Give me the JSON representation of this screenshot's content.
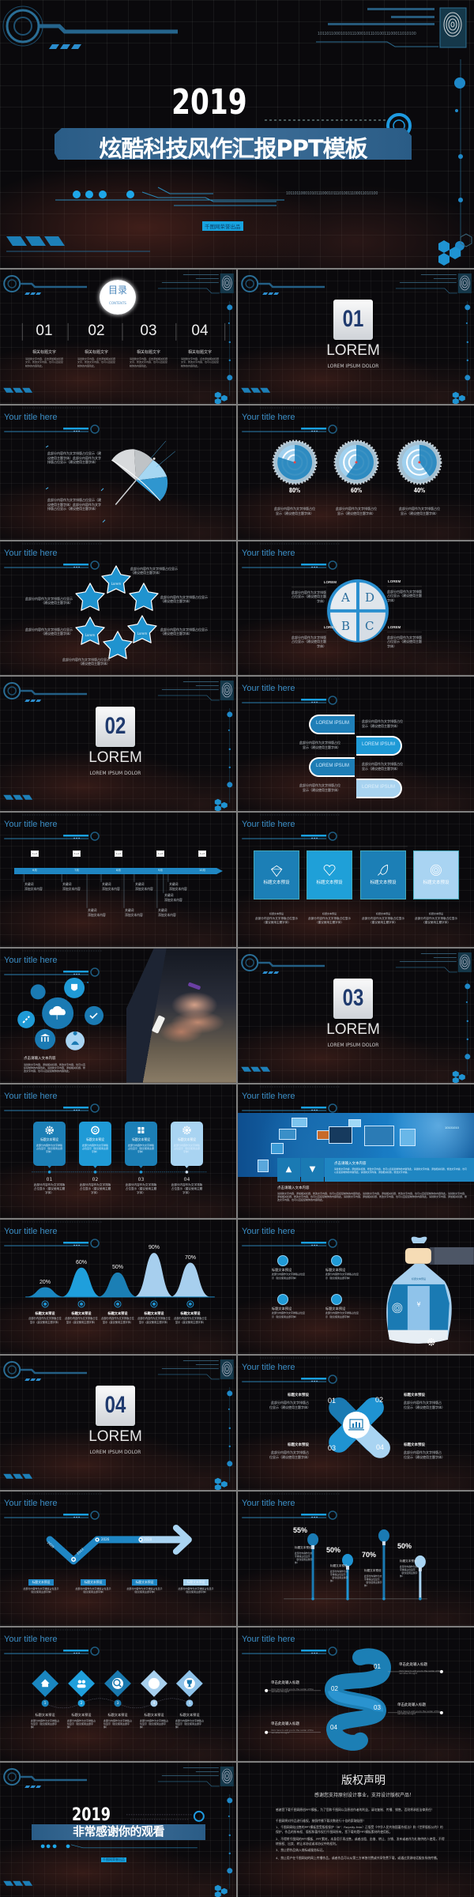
{
  "colors": {
    "accent": "#1f93d2",
    "accent_dark": "#1a7ab3",
    "accent_light": "#a9d3f1",
    "section_number": "#1f3a6e",
    "background": "#0a090c",
    "title_blue": "#3b8ec6"
  },
  "cover": {
    "year": "2019",
    "title": "炫酷科技风作汇报PPT模板",
    "tag": "千图网荣誉出品",
    "binary_top": "1011011000101011100010111010011100011010100",
    "binary_mid": "1011011000101011100010111010011100011010100"
  },
  "common": {
    "slide_title": "Your title here"
  },
  "slides": [
    {
      "type": "contents",
      "heading": "目录",
      "heading_en": "CONTENTS",
      "items": [
        {
          "num": "01",
          "label": "相关标题文字",
          "desc": "请替换文字内容，点击添加相关标题文字，修改文字内容，也可以直接复制你的内容到此。"
        },
        {
          "num": "02",
          "label": "相关标题文字",
          "desc": "请替换文字内容，点击添加相关标题文字，修改文字内容，也可以直接复制你的内容到此。"
        },
        {
          "num": "03",
          "label": "相关标题文字",
          "desc": "请替换文字内容，点击添加相关标题文字，修改文字内容，也可以直接复制你的内容到此。"
        },
        {
          "num": "04",
          "label": "相关标题文字",
          "desc": "请替换文字内容，点击添加相关标题文字，修改文字内容，也可以直接复制你的内容到此。"
        }
      ]
    },
    {
      "type": "section",
      "num": "01",
      "title": "LOREM",
      "subtitle": "LOREM IPSUM DOLOR"
    },
    {
      "type": "umbrella",
      "texts": [
        "此部分内容作为文字排版占位显示（建议使用主题字体）此部分内容作为文字排版占位显示（建议使用主题字体）",
        "此部分内容作为文字排版占位显示（建议使用主题字体）此部分内容作为文字排版占位显示（建议使用主题字体）"
      ]
    },
    {
      "type": "targets",
      "items": [
        {
          "pct": "80%",
          "value": 80,
          "text": "此部分内容作为文字排版占位显示（建议使用主题字体）"
        },
        {
          "pct": "60%",
          "value": 60,
          "text": "此部分内容作为文字排版占位显示（建议使用主题字体）"
        },
        {
          "pct": "40%",
          "value": 40,
          "text": "此部分内容作为文字排版占位显示（建议使用主题字体）"
        }
      ]
    },
    {
      "type": "stars",
      "labels": [
        "Lorem",
        "Lorem",
        "Lorem",
        "Lorem",
        "Lorem",
        "Lorem"
      ],
      "icons": [
        "user-icon",
        "home-icon",
        "heart-icon",
        "music-icon",
        "search-icon",
        "link-icon"
      ],
      "texts": [
        "此部分内容作为文字排版占位显示（建议使用主题字体）",
        "此部分内容作为文字排版占位显示（建议使用主题字体）",
        "此部分内容作为文字排版占位显示（建议使用主题字体）",
        "此部分内容作为文字排版占位显示（建议使用主题字体）",
        "此部分内容作为文字排版占位显示（建议使用主题字体）",
        "此部分内容作为文字排版占位显示（建议使用主题字体）"
      ]
    },
    {
      "type": "abcd",
      "letters": [
        "A",
        "D",
        "B",
        "C"
      ],
      "items": [
        {
          "label": "LOREM",
          "text": "此部分内容作为文字排版占位显示（建议使用主题字体）"
        },
        {
          "label": "LOREM",
          "text": "此部分内容作为文字排版占位显示（建议使用主题字体）"
        },
        {
          "label": "LOREM",
          "text": "此部分内容作为文字排版占位显示（建议使用主题字体）"
        },
        {
          "label": "LOREM",
          "text": "此部分内容作为文字排版占位显示（建议使用主题字体）"
        }
      ]
    },
    {
      "type": "section",
      "num": "02",
      "title": "LOREM",
      "subtitle": "LOREM IPSUM DOLOR"
    },
    {
      "type": "pills",
      "items": [
        {
          "label": "LOREM IPSUM",
          "text": "此部分内容作为文字排版占位显示（建议使用主题字体）"
        },
        {
          "label": "LOREM IPSUM",
          "text": "此部分内容作为文字排版占位显示（建议使用主题字体）"
        },
        {
          "label": "LOREM IPSUM",
          "text": "此部分内容作为文字排版占位显示（建议使用主题字体）"
        },
        {
          "label": "LOREM IPSUM",
          "text": "此部分内容作为文字排版占位显示（建议使用主题字体）"
        }
      ]
    },
    {
      "type": "timeline",
      "icon_label": "1+2",
      "months": [
        "6月",
        "7月",
        "8月",
        "9月",
        "10月"
      ],
      "items": [
        {
          "kw": "关键词",
          "text": "添加文本内容"
        },
        {
          "kw": "关键词",
          "text": "添加文本内容"
        },
        {
          "kw": "关键词",
          "text": "添加文本内容"
        },
        {
          "kw": "关键词",
          "text": "添加文本内容"
        },
        {
          "kw": "关键词",
          "text": "添加文本内容"
        },
        {
          "kw": "关键词",
          "text": "添加文本内容"
        },
        {
          "kw": "关键词",
          "text": "添加文本内容"
        },
        {
          "kw": "关键词",
          "text": "添加文本内容"
        },
        {
          "kw": "关键词",
          "text": "添加文本内容"
        }
      ]
    },
    {
      "type": "boxes",
      "items": [
        {
          "icon": "diamond-icon",
          "label": "标题文本预设",
          "cap_title": "标题文本预设",
          "caption": "此部分内容作为文字排版占位显示（建议使用主题字体）"
        },
        {
          "icon": "heart-icon",
          "label": "标题文本预设",
          "cap_title": "标题文本预设",
          "caption": "此部分内容作为文字排版占位显示（建议使用主题字体）"
        },
        {
          "icon": "rocket-icon",
          "label": "标题文本预设",
          "cap_title": "标题文本预设",
          "caption": "此部分内容作为文字排版占位显示（建议使用主题字体）"
        },
        {
          "icon": "target-icon",
          "label": "标题文本预设",
          "cap_title": "标题文本预设",
          "caption": "此部分内容作为文字排版占位显示（建议使用主题字体）"
        }
      ]
    },
    {
      "type": "circles",
      "cap_title": "点击请输入文本内容",
      "caption": "请替换文字内容，添加相关标题，修改文字内容，也可以直接复制你的内容到此。请替换文字内容，添加相关标题，修改文字内容，也可以直接复制你的内容到此。"
    },
    {
      "type": "section",
      "num": "03",
      "title": "LOREM",
      "subtitle": "LOREM IPSUM DOLOR"
    },
    {
      "type": "cards",
      "items": [
        {
          "icon": "gear-icon",
          "label": "标题文本预设",
          "text": "此部分内容作为文字排版占位显示（建议使用主题字体）",
          "num": "01",
          "caption": "此部分内容作为文字排版占位显示（建议使用主题字体）"
        },
        {
          "icon": "aperture-icon",
          "label": "标题文本预设",
          "text": "此部分内容作为文字排版占位显示（建议使用主题字体）",
          "num": "02",
          "caption": "此部分内容作为文字排版占位显示（建议使用主题字体）"
        },
        {
          "icon": "windows-icon",
          "label": "标题文本预设",
          "text": "此部分内容作为文字排版占位显示（建议使用主题字体）",
          "num": "03",
          "caption": "此部分内容作为文字排版占位显示（建议使用主题字体）"
        },
        {
          "icon": "gear-icon",
          "label": "标题文本预设",
          "text": "此部分内容作为文字排版占位显示（建议使用主题字体）",
          "num": "04",
          "caption": "此部分内容作为文字排版占位显示（建议使用主题字体）"
        }
      ]
    },
    {
      "type": "banner",
      "panel_title": "点击请输入文本内容",
      "panel_text": "请替换文字内容，添加相关标题，修改文字内容，也可以直接复制你的内容到此。请替换文字内容，添加相关标题，修改文字内容，也可以直接复制你的内容到此。请替换文字内容，添加相关标题，修改文字内容。",
      "binary": "10101010",
      "below_title": "点击请输入文本内容",
      "below_text": "请替换文字内容，添加相关标题，修改文字内容，也可以直接复制你的内容到此。请替换文字内容，添加相关标题，修改文字内容，也可以直接复制你的内容到此。请替换文字内容，添加相关标题，修改文字内容，也可以直接复制你的内容到此。请替换文字内容，添加相关标题，修改文字内容，也可以直接复制你的内容到此。请替换文字内容，添加相关标题，修改文字内容，也可以直接复制你的内容到此。"
    },
    {
      "type": "curves",
      "items": [
        {
          "value": 20,
          "pct": "20%",
          "title": "标题文本预设",
          "text": "此部分内容作为文字排版占位显示（建议使用主题字体）"
        },
        {
          "value": 60,
          "pct": "60%",
          "title": "标题文本预设",
          "text": "此部分内容作为文字排版占位显示（建议使用主题字体）"
        },
        {
          "value": 50,
          "pct": "50%",
          "title": "标题文本预设",
          "text": "此部分内容作为文字排版占位显示（建议使用主题字体）"
        },
        {
          "value": 90,
          "pct": "90%",
          "title": "标题文本预设",
          "text": "此部分内容作为文字排版占位显示（建议使用主题字体）"
        },
        {
          "value": 70,
          "pct": "70%",
          "title": "标题文本预设",
          "text": "此部分内容作为文字排版占位显示（建议使用主题字体）"
        }
      ]
    },
    {
      "type": "moneybag",
      "bag_label": "标题文本预设",
      "bag_symbol": "¥",
      "items": [
        {
          "title": "标题文本预设",
          "text": "此部分内容作为文字排版占位显示（建议使用主题字体）"
        },
        {
          "title": "标题文本预设",
          "text": "此部分内容作为文字排版占位显示（建议使用主题字体）"
        },
        {
          "title": "标题文本预设",
          "text": "此部分内容作为文字排版占位显示（建议使用主题字体）"
        },
        {
          "title": "标题文本预设",
          "text": "此部分内容作为文字排版占位显示（建议使用主题字体）"
        }
      ]
    },
    {
      "type": "section",
      "num": "04",
      "title": "LOREM",
      "subtitle": "LOREM IPSUM DOLOR"
    },
    {
      "type": "xshape",
      "items": [
        {
          "num": "01",
          "title": "标题文本预设",
          "text": "此部分内容作为文字排版占位显示（建议使用主题字体）"
        },
        {
          "num": "02",
          "title": "标题文本预设",
          "text": "此部分内容作为文字排版占位显示（建议使用主题字体）"
        },
        {
          "num": "03",
          "title": "标题文本预设",
          "text": "此部分内容作为文字排版占位显示（建议使用主题字体）"
        },
        {
          "num": "04",
          "title": "标题文本预设",
          "text": "此部分内容作为文字排版占位显示（建议使用主题字体）"
        }
      ]
    },
    {
      "type": "arrow",
      "years": [
        "2020",
        "2022",
        "2026",
        "2028"
      ],
      "items": [
        {
          "label": "标题文本预设",
          "text": "此部分内容作为文字排版占位显示（建议使用主题字体）"
        },
        {
          "label": "标题文本预设",
          "text": "此部分内容作为文字排版占位显示（建议使用主题字体）"
        },
        {
          "label": "标题文本预设",
          "text": "此部分内容作为文字排版占位显示（建议使用主题字体）"
        },
        {
          "label": "标题文本预设",
          "text": "此部分内容作为文字排版占位显示（建议使用主题字体）"
        }
      ]
    },
    {
      "type": "bulbs",
      "items": [
        {
          "pct": "55%",
          "value": 55,
          "title": "标题文本预设",
          "text": "此部分内容作为文字排版占位显示（建议使用主题字体）"
        },
        {
          "pct": "50%",
          "value": 50,
          "title": "标题文本预设",
          "text": "此部分内容作为文字排版占位显示（建议使用主题字体）"
        },
        {
          "pct": "70%",
          "value": 70,
          "title": "标题文本预设",
          "text": "此部分内容作为文字排版占位显示（建议使用主题字体）"
        },
        {
          "pct": "50%",
          "value": 50,
          "title": "标题文本预设",
          "text": "此部分内容作为文字排版占位显示（建议使用主题字体）"
        }
      ]
    },
    {
      "type": "diamonds",
      "items": [
        {
          "num": "1",
          "icon": "home-icon",
          "title": "标题文本预设",
          "text": "此部分内容作为文字排版占位显示（建议使用主题字体）"
        },
        {
          "num": "2",
          "icon": "users-icon",
          "title": "标题文本预设",
          "text": "此部分内容作为文字排版占位显示（建议使用主题字体）"
        },
        {
          "num": "3",
          "icon": "search-icon",
          "title": "标题文本预设",
          "text": "此部分内容作为文字排版占位显示（建议使用主题字体）"
        },
        {
          "num": "4",
          "icon": "gear-icon",
          "title": "标题文本预设",
          "text": "此部分内容作为文字排版占位显示（建议使用主题字体）"
        },
        {
          "num": "5",
          "icon": "trophy-icon",
          "title": "标题文本预设",
          "text": "此部分内容作为文字排版占位显示（建议使用主题字体）"
        }
      ]
    },
    {
      "type": "ribbon",
      "items": [
        {
          "num": "01",
          "title": "单击此处输入标题",
          "text": "Click here to add you to the center of the narrative thought"
        },
        {
          "num": "02",
          "title": "单击此处输入标题",
          "text": "Click here to add you to the center of the narrative thought"
        },
        {
          "num": "03",
          "title": "单击此处输入标题",
          "text": "Click here to add you to the center of the narrative thought"
        },
        {
          "num": "04",
          "title": "单击此处输入标题",
          "text": "Click here to add you to the center of the narrative thought"
        }
      ]
    },
    {
      "type": "thanks",
      "year": "2019",
      "title": "非常感谢你的观看",
      "tag": "千图网荣誉出品"
    },
    {
      "type": "copyright",
      "title": "版权声明",
      "subtitle": "感谢您支持原创设计事业，支持设计版权产品！",
      "paragraphs": [
        "感谢您下载千图网原创PPT模板，为了您和千图网以及原创作者的利益，请勿复制、传播、销售，否则将承担法律责任！",
        "千图网将对作品进行维权，按照传播下载次数进行十倍的索取赔偿！",
        "1、千图网网站出售的PPT模板是受版权保护（RF：Royalty-free）正版受《中华人民共和国著作权法》和《世界版权公约》的保护，作品的所有权、版权和著作权归千图网所有，您下载的是PPT模板素材的使用权。",
        "2、不得将千图网的PPT模板、PPT素材，本身用于再出售，或者出租、出借、转让、分销、发布或者作为礼物供他人使用，不得转授权、出卖、转让本协议或本协议中的权利。",
        "3、禁止把作品纳入商标或服务标记。",
        "4、禁止用户在千图网站的网上传播作品，或者作品可以从第三方单独付费或共享免费下载，或通过资源电话服务系统传播。"
      ]
    }
  ]
}
